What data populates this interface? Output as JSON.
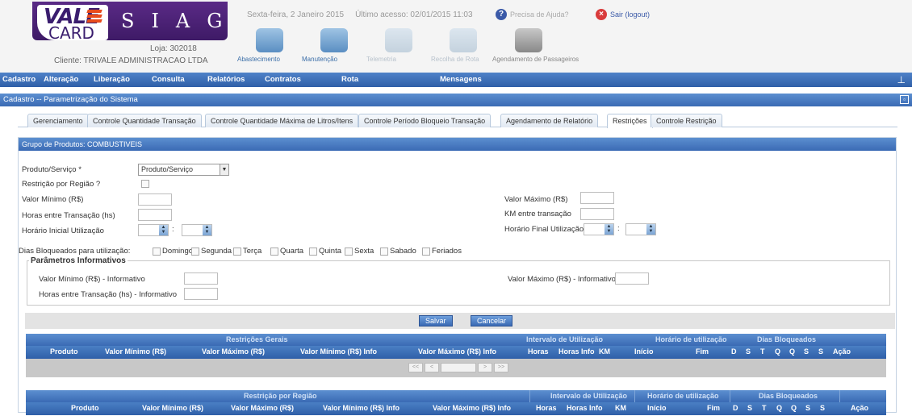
{
  "header": {
    "logo_vale": "VALE",
    "logo_card": "CARD",
    "logo_siag": "SIAG",
    "loja": "Loja: 302018",
    "cliente": "Cliente: TRIVALE ADMINISTRACAO LTDA",
    "date": "Sexta-feira, 2 Janeiro 2015",
    "last_access": "Último acesso: 02/01/2015 11:03",
    "help": "Precisa de Ajuda?",
    "logout": "Sair (logout)"
  },
  "modules": [
    {
      "label": "Abastecimento",
      "state": "active"
    },
    {
      "label": "Manutenção",
      "state": "active"
    },
    {
      "label": "Telemetria",
      "state": "disabled"
    },
    {
      "label": "Recolha de Rota",
      "state": "disabled"
    },
    {
      "label": "Agendamento de Passageiros",
      "state": "car"
    }
  ],
  "menu": [
    "Cadastro",
    "Alteração",
    "Liberação",
    "Consulta",
    "Relatórios",
    "Contratos",
    "Rota",
    "Mensagens"
  ],
  "panel": {
    "title": "Cadastro -- Parametrização do Sistema"
  },
  "tabs": [
    "Gerenciamento",
    "Controle Quantidade Transação",
    "Controle Quantidade Máxima de Litros/Itens",
    "Controle Período Bloqueio Transação",
    "Agendamento de Relatório",
    "Restrições",
    "Controle Restrição"
  ],
  "active_tab": "Restrições",
  "group": {
    "title": "Grupo de Produtos: COMBUSTIVEIS"
  },
  "form": {
    "produto_label": "Produto/Serviço *",
    "produto_value": "Produto/Serviço",
    "restricao_regiao_label": "Restrição por Região ?",
    "valor_minimo_label": "Valor Mínimo (R$)",
    "horas_label": "Horas entre Transação (hs)",
    "horario_inicial_label": "Horário Inicial Utilização",
    "valor_maximo_label": "Valor Máximo (R$)",
    "km_label": "KM entre transação",
    "horario_final_label": "Horário Final Utilização",
    "time_sep": ":",
    "dias_label": "Dias Bloqueados para utilização:",
    "dias": [
      "Domingo",
      "Segunda",
      "Terça",
      "Quarta",
      "Quinta",
      "Sexta",
      "Sabado",
      "Feriados"
    ],
    "parametros_legend": "Parâmetros Informativos",
    "valor_minimo_info_label": "Valor Mínimo (R$) - Informativo",
    "horas_info_label": "Horas entre Transação (hs) - Informativo",
    "valor_maximo_info_label": "Valor Máximo (R$) - Informativo",
    "salvar": "Salvar",
    "cancelar": "Cancelar"
  },
  "grid1": {
    "groups": [
      "Restrições Gerais",
      "Intervalo de Utilização",
      "Horário de utilização",
      "Dias Bloqueados"
    ],
    "columns": [
      "Produto",
      "Valor Mínimo (R$)",
      "Valor Máximo (R$)",
      "Valor Mínimo (R$) Info",
      "Valor Máximo (R$) Info",
      "Horas",
      "Horas Info",
      "KM",
      "Início",
      "Fim",
      "D",
      "S",
      "T",
      "Q",
      "Q",
      "S",
      "S",
      "Ação"
    ]
  },
  "grid2": {
    "groups": [
      "Restrição por Região",
      "Intervalo de Utilização",
      "Horário de utilização",
      "Dias Bloqueados"
    ],
    "columns": [
      "Produto",
      "Valor Mínimo (R$)",
      "Valor Máximo (R$)",
      "Valor Mínimo (R$) Info",
      "Valor Máximo (R$) Info",
      "Horas",
      "Horas Info",
      "KM",
      "Início",
      "Fim",
      "D",
      "S",
      "T",
      "Q",
      "Q",
      "S",
      "S",
      "Ação"
    ]
  },
  "pager": [
    "<<",
    "<",
    ">",
    ">>"
  ]
}
